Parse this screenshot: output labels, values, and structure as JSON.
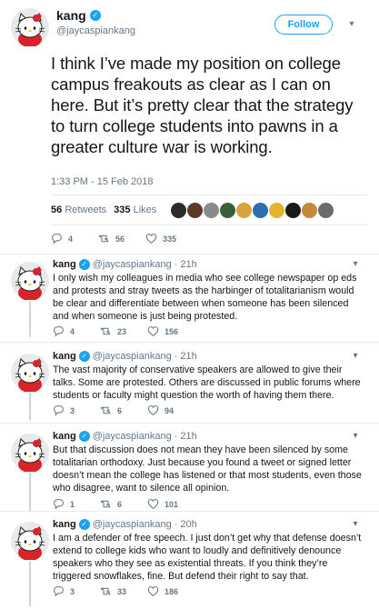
{
  "main_tweet": {
    "author_name": "kang",
    "author_handle": "@jaycaspiankang",
    "follow_label": "Follow",
    "text": "I think I’ve made my position on college campus freakouts as clear as I can on here. But it’s pretty clear that the strategy to turn college students into pawns in a greater culture war is working.",
    "timestamp": "1:33 PM - 15 Feb 2018",
    "retweets_count": "56",
    "retweets_label": "Retweets",
    "likes_count": "335",
    "likes_label": "Likes",
    "reply_count": "4",
    "retweet_count": "56",
    "like_count": "335"
  },
  "liker_colors": [
    "#2b2b2b",
    "#5b3a29",
    "#8a8a8a",
    "#3a5f3a",
    "#d9a23b",
    "#2a6fb0",
    "#e3b52a",
    "#1a1a1a",
    "#c48a3a",
    "#6b6b6b"
  ],
  "replies": [
    {
      "author_name": "kang",
      "author_handle": "@jaycaspiankang",
      "time": "21h",
      "text": "I only wish my colleagues in media who see college newspaper op eds and protests and stray tweets as the harbinger of totalitarianism would be clear and differentiate between when someone has been silenced and when someone is just being protested.",
      "reply_count": "4",
      "retweet_count": "23",
      "like_count": "156"
    },
    {
      "author_name": "kang",
      "author_handle": "@jaycaspiankang",
      "time": "21h",
      "text": "The vast majority of conservative speakers are allowed to give their talks. Some are protested. Others are discussed in public forums where students or faculty might question the worth of having them there.",
      "reply_count": "3",
      "retweet_count": "6",
      "like_count": "94"
    },
    {
      "author_name": "kang",
      "author_handle": "@jaycaspiankang",
      "time": "21h",
      "text": "But that discussion does not mean they have been silenced by some totalitarian orthodoxy. Just because you found a tweet or signed letter doesn’t mean the college has listened or that most students, even those who disagree, want to silence all opinion.",
      "reply_count": "1",
      "retweet_count": "6",
      "like_count": "101"
    },
    {
      "author_name": "kang",
      "author_handle": "@jaycaspiankang",
      "time": "20h",
      "text": "I am a defender of free speech. I just don’t get why that defense doesn’t extend to college kids who want to loudly and definitively denounce speakers who they see as existential threats. If you think they’re triggered snowflakes, fine. But defend their right to say that.",
      "reply_count": "3",
      "retweet_count": "33",
      "like_count": "186"
    }
  ]
}
